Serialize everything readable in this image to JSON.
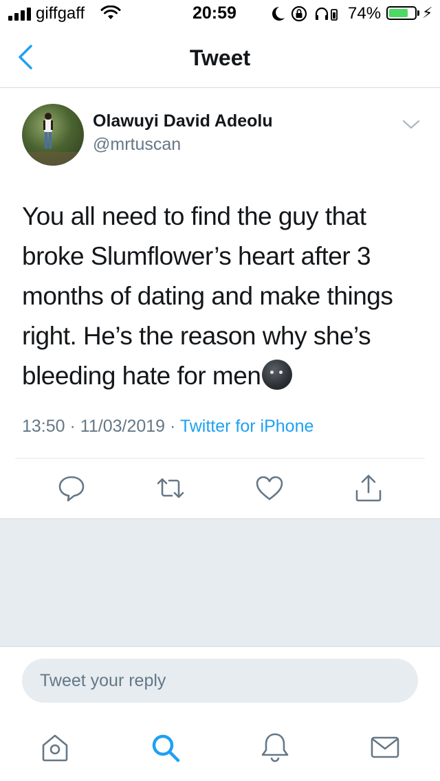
{
  "status_bar": {
    "carrier": "giffgaff",
    "time": "20:59",
    "battery_percent": "74%",
    "battery_level": 0.74,
    "icons": [
      "signal-icon",
      "wifi-icon",
      "moon-icon",
      "rotation-lock-icon",
      "headphones-icon",
      "battery-icon",
      "charging-bolt-icon"
    ]
  },
  "nav": {
    "title": "Tweet",
    "back_icon": "chevron-left-icon"
  },
  "tweet": {
    "display_name": "Olawuyi David Adeolu",
    "handle": "@mrtuscan",
    "text": "You all need to find the guy that broke Slumflower’s heart after 3 months of dating and make things right. He’s the reason why she’s bleeding hate for men",
    "emoji": "new-moon-face-emoji",
    "time": "13:50",
    "date": "11/03/2019",
    "separator": "·",
    "source": "Twitter for iPhone"
  },
  "actions": [
    "reply-icon",
    "retweet-icon",
    "like-icon",
    "share-icon"
  ],
  "reply": {
    "placeholder": "Tweet your reply"
  },
  "tab_bar": [
    "home-icon",
    "search-icon",
    "notifications-icon",
    "messages-icon"
  ],
  "colors": {
    "accent": "#1da1f2",
    "text": "#14171a",
    "secondary_text": "#657786",
    "divider": "#e1e8ed",
    "background_grey": "#e6ecf0",
    "battery": "#4cd964"
  }
}
